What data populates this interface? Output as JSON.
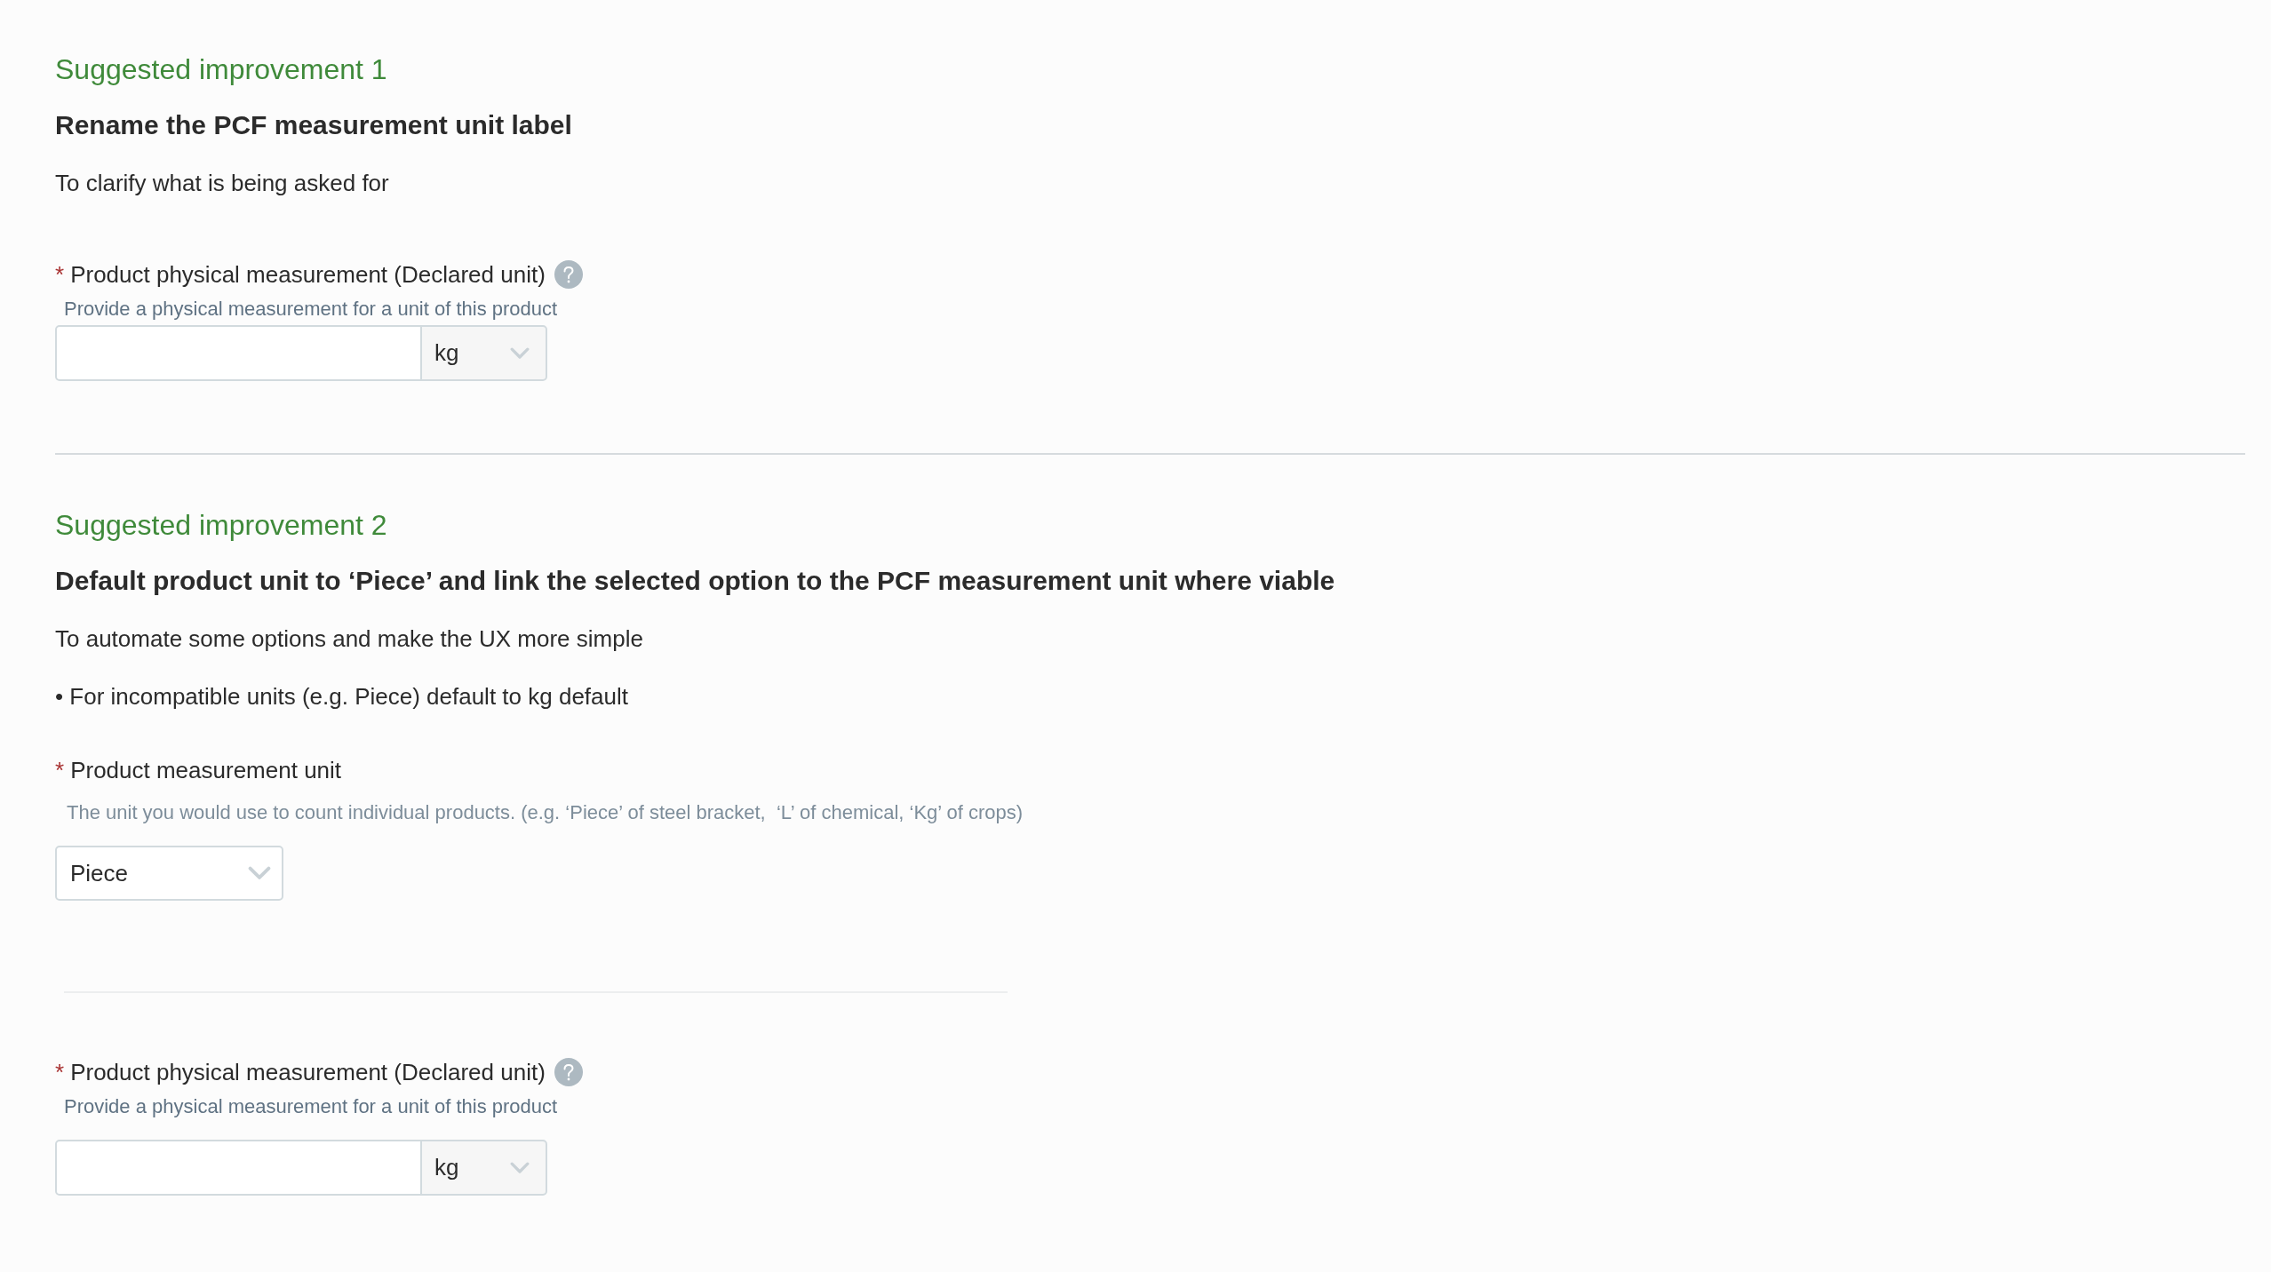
{
  "sections": [
    {
      "kicker": "Suggested improvement 1",
      "title": "Rename the PCF measurement unit label",
      "description": [
        "To clarify what is being asked for"
      ],
      "fields": [
        {
          "kind": "measurement",
          "required_mark": "*",
          "label": "Product physical measurement (Declared unit)",
          "help_icon": true,
          "help_text": "Provide a physical measurement for a unit of this product",
          "unit": "kg"
        }
      ]
    },
    {
      "kicker": "Suggested improvement 2",
      "title": "Default product unit to ‘Piece’ and link the selected option to the PCF measurement unit where viable",
      "description": [
        "To automate some options and make the UX more simple",
        "• For incompatible units (e.g. Piece) default to kg default"
      ],
      "fields": [
        {
          "kind": "select",
          "required_mark": "*",
          "label": "Product measurement unit",
          "help_icon": false,
          "help_text": "The unit you would use to count individual products. (e.g. ‘Piece’ of steel bracket,  ‘L’ of chemical, ‘Kg’ of crops)",
          "value": "Piece"
        },
        {
          "kind": "divider"
        },
        {
          "kind": "measurement",
          "required_mark": "*",
          "label": "Product physical measurement (Declared unit)",
          "help_icon": true,
          "help_text": "Provide a physical measurement for a unit of this product",
          "unit": "kg"
        }
      ]
    }
  ]
}
